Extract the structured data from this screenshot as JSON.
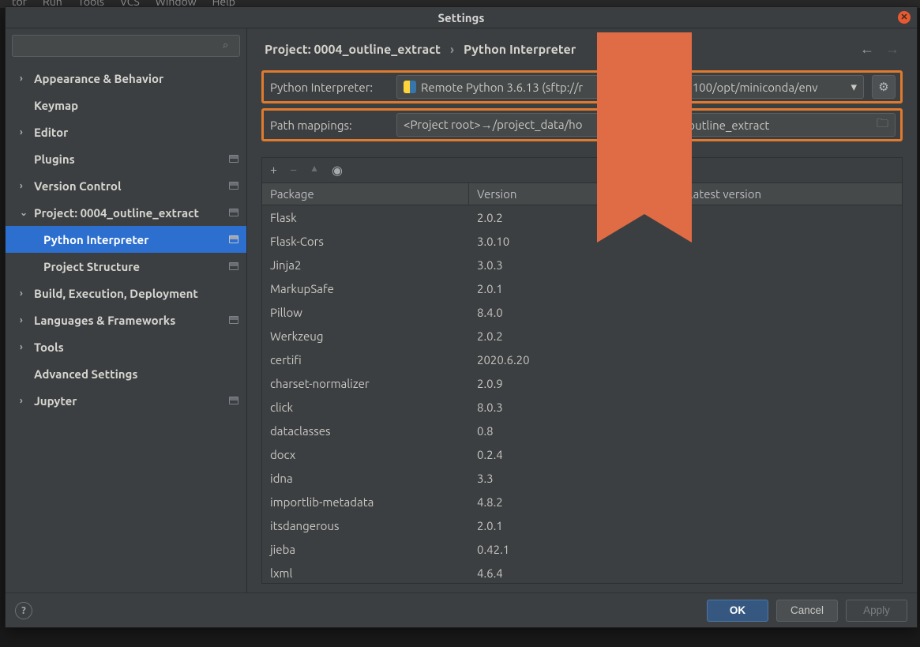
{
  "menubar": [
    "tor",
    "Run",
    "Tools",
    "VCS",
    "Window",
    "Help"
  ],
  "window": {
    "title": "Settings"
  },
  "search": {
    "placeholder": ""
  },
  "sidebar": {
    "items": [
      {
        "label": "Appearance & Behavior",
        "expand": true,
        "chev": "›",
        "pin": false
      },
      {
        "label": "Keymap",
        "expand": false,
        "chev": "",
        "pin": false
      },
      {
        "label": "Editor",
        "expand": true,
        "chev": "›",
        "pin": false
      },
      {
        "label": "Plugins",
        "expand": false,
        "chev": "",
        "pin": true
      },
      {
        "label": "Version Control",
        "expand": true,
        "chev": "›",
        "pin": true
      },
      {
        "label": "Project: 0004_outline_extract",
        "expand": true,
        "chev": "⌄",
        "pin": true
      },
      {
        "label": "Python Interpreter",
        "expand": false,
        "chev": "",
        "pin": true,
        "child": true,
        "selected": true
      },
      {
        "label": "Project Structure",
        "expand": false,
        "chev": "",
        "pin": true,
        "child": true
      },
      {
        "label": "Build, Execution, Deployment",
        "expand": true,
        "chev": "›",
        "pin": false
      },
      {
        "label": "Languages & Frameworks",
        "expand": true,
        "chev": "›",
        "pin": true
      },
      {
        "label": "Tools",
        "expand": true,
        "chev": "›",
        "pin": false
      },
      {
        "label": "Advanced Settings",
        "expand": false,
        "chev": "",
        "pin": false
      },
      {
        "label": "Jupyter",
        "expand": true,
        "chev": "›",
        "pin": true
      }
    ]
  },
  "breadcrumb": {
    "a": "Project: 0004_outline_extract",
    "sep": "›",
    "b": "Python Interpreter"
  },
  "interpreter": {
    "label": "Python Interpreter:",
    "value_left": "Remote Python 3.6.13 (sftp://r",
    "value_right": "5:5100/opt/miniconda/env"
  },
  "mappings": {
    "label": "Path mappings:",
    "value_left": "<Project root>→/project_data/ho",
    "value_right": "4_outline_extract"
  },
  "package_table": {
    "headers": {
      "pkg": "Package",
      "ver": "Version",
      "lat": "Latest version"
    },
    "rows": [
      {
        "pkg": "Flask",
        "ver": "2.0.2"
      },
      {
        "pkg": "Flask-Cors",
        "ver": "3.0.10"
      },
      {
        "pkg": "Jinja2",
        "ver": "3.0.3"
      },
      {
        "pkg": "MarkupSafe",
        "ver": "2.0.1"
      },
      {
        "pkg": "Pillow",
        "ver": "8.4.0"
      },
      {
        "pkg": "Werkzeug",
        "ver": "2.0.2"
      },
      {
        "pkg": "certifi",
        "ver": "2020.6.20"
      },
      {
        "pkg": "charset-normalizer",
        "ver": "2.0.9"
      },
      {
        "pkg": "click",
        "ver": "8.0.3"
      },
      {
        "pkg": "dataclasses",
        "ver": "0.8"
      },
      {
        "pkg": "docx",
        "ver": "0.2.4"
      },
      {
        "pkg": "idna",
        "ver": "3.3"
      },
      {
        "pkg": "importlib-metadata",
        "ver": "4.8.2"
      },
      {
        "pkg": "itsdangerous",
        "ver": "2.0.1"
      },
      {
        "pkg": "jieba",
        "ver": "0.42.1"
      },
      {
        "pkg": "lxml",
        "ver": "4.6.4"
      }
    ]
  },
  "buttons": {
    "ok": "OK",
    "cancel": "Cancel",
    "apply": "Apply"
  },
  "icons": {
    "add": "+",
    "remove": "−",
    "up": "▲",
    "eye": "◉",
    "gear": "⚙",
    "folder": "🗀",
    "dd": "▾",
    "back": "←",
    "fwd": "→",
    "help": "?",
    "search": "⌕",
    "close": "✕"
  }
}
